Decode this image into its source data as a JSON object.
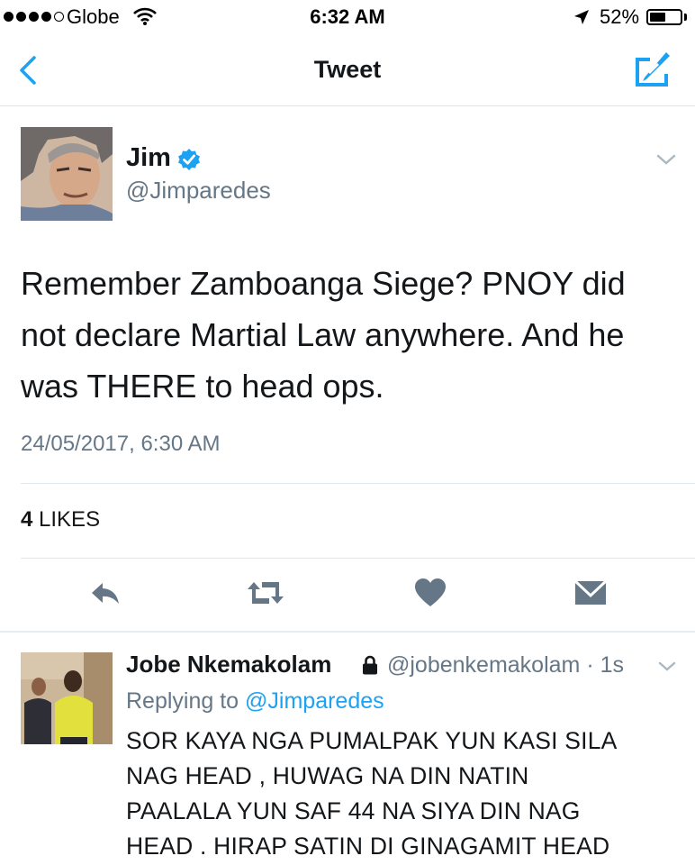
{
  "status_bar": {
    "carrier": "Globe",
    "time": "6:32 AM",
    "battery_percent": "52%",
    "battery_level": 0.52
  },
  "nav": {
    "title": "Tweet",
    "accent_color": "#1da1f2"
  },
  "tweet": {
    "author_name": "Jim",
    "handle": "@Jimparedes",
    "lines": [
      "Remember Zamboanga Siege? PNOY did",
      "not declare Martial Law anywhere. And he",
      "was THERE to head ops."
    ],
    "timestamp": "24/05/2017, 6:30 AM",
    "likes_count": "4",
    "likes_label": "LIKES",
    "actions": [
      "reply-icon",
      "retweet-icon",
      "like-icon",
      "message-icon"
    ]
  },
  "reply": {
    "author_name": "Jobe Nkemakolam",
    "handle_time": "@jobenkemakolam · 1s",
    "replying_prefix": "Replying to",
    "replying_to": "@Jimparedes",
    "lines": [
      "SOR KAYA NGA PUMALPAK YUN KASI SILA",
      "NAG HEAD , HUWAG NA DIN NATIN",
      "PAALALA YUN SAF 44 NA SIYA DIN NAG",
      "HEAD . HIRAP SATIN DI GINAGAMIT HEAD"
    ]
  }
}
